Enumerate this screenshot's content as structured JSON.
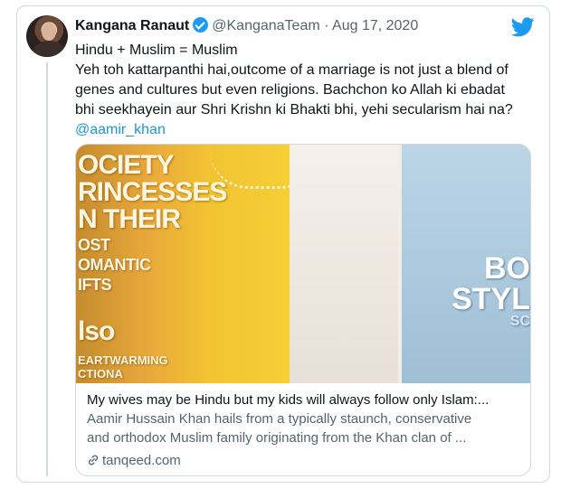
{
  "tweet": {
    "display_name": "Kangana Ranaut",
    "handle": "@KanganaTeam",
    "separator": "·",
    "date": "Aug 17, 2020",
    "text_lines": [
      "Hindu + Muslim = Muslim",
      "Yeh toh kattarpanthi hai,outcome of a marriage is not just a blend of",
      "genes and cultures but even religions. Bachchon ko Allah ki ebadat",
      "bhi seekhayein aur Shri Krishn ki Bhakti bhi, yehi secularism hai na?"
    ],
    "mention": "@aamir_khan"
  },
  "link_card": {
    "title": "My wives may be Hindu but my kids will always follow only Islam:...",
    "description_lines": [
      "Aamir Hussain Khan hails from a typically staunch, conservative",
      "and orthodox Muslim family originating from the Khan clan of ..."
    ],
    "domain": "tanqeed.com",
    "image_text": {
      "line1": "OCIETY",
      "line2": "RINCESSES",
      "line3": "N THEIR",
      "line4": "OST",
      "line5": "OMANTIC",
      "line6": "IFTS",
      "line7": "lso",
      "line8": "EARTWARMING",
      "line9": "CTIONA",
      "right1": "BO",
      "right2": "STYL",
      "right3": "SC"
    }
  },
  "icons": {
    "verified": "verified-badge-icon",
    "twitter": "twitter-bird-icon",
    "link": "link-icon"
  },
  "colors": {
    "accent": "#1d9bf0",
    "mention": "#1b95e0",
    "secondary_text": "#536471",
    "border": "#cfd9de"
  }
}
